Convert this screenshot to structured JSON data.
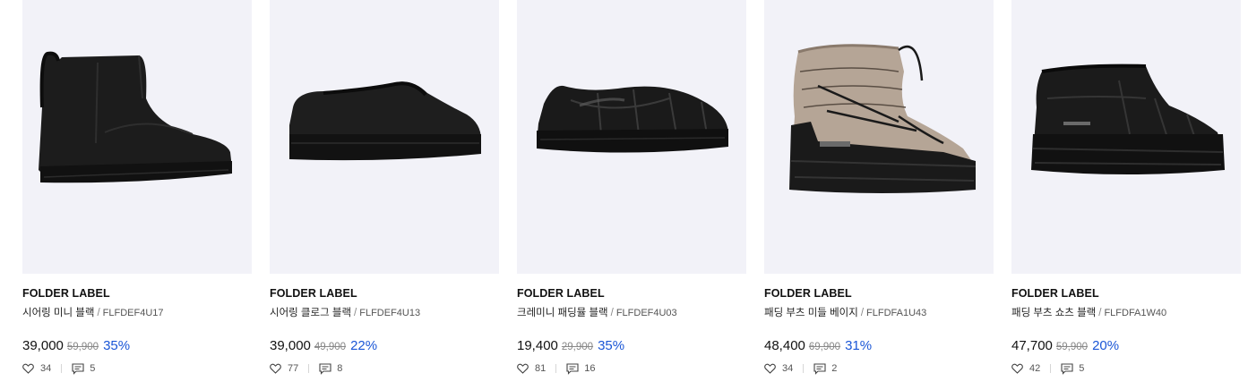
{
  "products": [
    {
      "brand": "FOLDER LABEL",
      "name": "시어링 미니 블랙",
      "separator": "/",
      "code": "FLFDEF4U17",
      "price": "39,000",
      "original_price": "59,900",
      "discount": "35%",
      "likes": "34",
      "reviews": "5",
      "image_icon": "shearling-mini-boot-black"
    },
    {
      "brand": "FOLDER LABEL",
      "name": "시어링 클로그 블랙",
      "separator": "/",
      "code": "FLFDEF4U13",
      "price": "39,000",
      "original_price": "49,900",
      "discount": "22%",
      "likes": "77",
      "reviews": "8",
      "image_icon": "shearling-clog-black"
    },
    {
      "brand": "FOLDER LABEL",
      "name": "크레미니 패딩뮬 블랙",
      "separator": "/",
      "code": "FLFDEF4U03",
      "price": "19,400",
      "original_price": "29,900",
      "discount": "35%",
      "likes": "81",
      "reviews": "16",
      "image_icon": "padded-mule-black"
    },
    {
      "brand": "FOLDER LABEL",
      "name": "패딩 부츠 미들 베이지",
      "separator": "/",
      "code": "FLFDFA1U43",
      "price": "48,400",
      "original_price": "69,900",
      "discount": "31%",
      "likes": "34",
      "reviews": "2",
      "image_icon": "padded-boot-middle-beige"
    },
    {
      "brand": "FOLDER LABEL",
      "name": "패딩 부츠 쇼츠 블랙",
      "separator": "/",
      "code": "FLFDFA1W40",
      "price": "47,700",
      "original_price": "59,900",
      "discount": "20%",
      "likes": "42",
      "reviews": "5",
      "image_icon": "padded-boot-short-black"
    }
  ],
  "colors": {
    "thumb_background": "#f2f2f8",
    "discount": "#1a56d6",
    "brand_text": "#111111",
    "muted_text": "#888888"
  }
}
